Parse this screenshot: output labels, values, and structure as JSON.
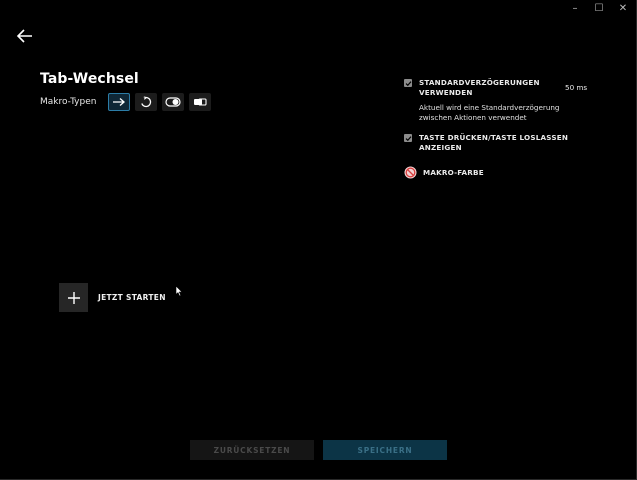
{
  "window_controls": {
    "minimize": "–",
    "maximize": "☐",
    "close": "✕"
  },
  "header": {
    "title": "Tab-Wechsel",
    "macro_types_label": "Makro-Typen"
  },
  "macro_types": [
    {
      "icon": "arrow-right-icon",
      "active": true
    },
    {
      "icon": "repeat-icon",
      "active": false
    },
    {
      "icon": "toggle-icon",
      "active": false
    },
    {
      "icon": "hold-icon",
      "active": false
    }
  ],
  "settings": {
    "default_delays_label": "STANDARDVERZÖGERUNGEN VERWENDEN",
    "default_delays_checked": true,
    "delay_value": "50 ms",
    "default_delays_description": "Aktuell wird eine Standardverzögerung zwischen Aktionen verwendet",
    "show_press_release_label": "TASTE DRÜCKEN/TASTE LOSLASSEN ANZEIGEN",
    "show_press_release_checked": true,
    "macro_color_label": "MAKRO-FARBE",
    "macro_color_icon": "no-color-icon",
    "macro_color_accent": "#e05050"
  },
  "start": {
    "label": "JETZT STARTEN"
  },
  "footer": {
    "reset_label": "ZURÜCKSETZEN",
    "save_label": "SPEICHERN"
  },
  "colors": {
    "accent": "#2c7da7",
    "save_bg": "#0c3446"
  }
}
